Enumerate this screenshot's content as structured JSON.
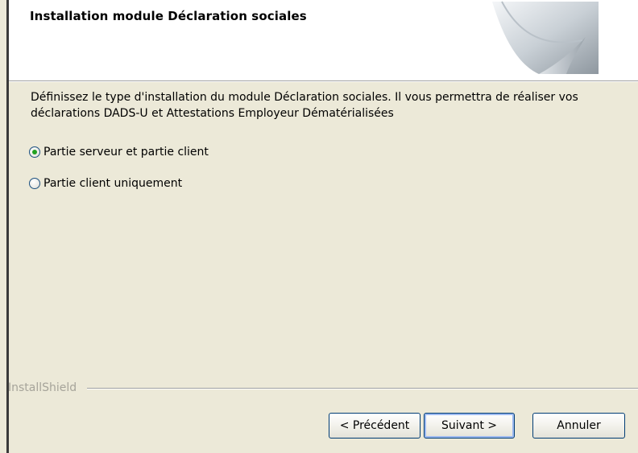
{
  "window": {
    "title": "Installation module Déclaration sociales"
  },
  "body": {
    "description": "Définissez le type d'installation du module Déclaration sociales. Il vous permettra de réaliser vos déclarations DADS-U et Attestations Employeur Dématérialisées"
  },
  "options": [
    {
      "label": "Partie serveur et partie client",
      "selected": true
    },
    {
      "label": "Partie client uniquement",
      "selected": false
    }
  ],
  "footer": {
    "brand": "InstallShield"
  },
  "buttons": {
    "previous": "< Précédent",
    "next": "Suivant >",
    "cancel": "Annuler"
  },
  "colors": {
    "dialog_bg": "#ece9d8",
    "header_bg": "#ffffff",
    "radio_selected": "#21a121",
    "button_border": "#003c74"
  }
}
